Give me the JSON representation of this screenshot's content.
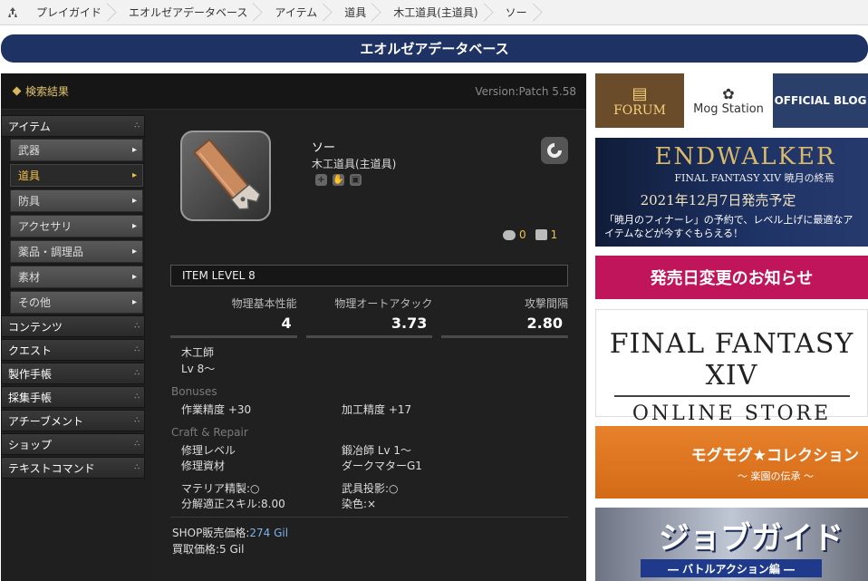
{
  "breadcrumb": {
    "items": [
      "プレイガイド",
      "エオルゼアデータベース",
      "アイテム",
      "道具",
      "木工道具(主道具)",
      "ソー"
    ]
  },
  "header": {
    "title": "エオルゼアデータベース"
  },
  "panel": {
    "search_result": "検索結果",
    "version": "Version:Patch 5.58"
  },
  "sidebar": {
    "item_category": "アイテム",
    "subs": [
      {
        "label": "武器",
        "active": false
      },
      {
        "label": "道具",
        "active": true
      },
      {
        "label": "防具",
        "active": false
      },
      {
        "label": "アクセサリ",
        "active": false
      },
      {
        "label": "薬品・調理品",
        "active": false
      },
      {
        "label": "素材",
        "active": false
      },
      {
        "label": "その他",
        "active": false
      }
    ],
    "categories": [
      "コンテンツ",
      "クエスト",
      "製作手帳",
      "採集手帳",
      "アチーブメント",
      "ショップ",
      "テキストコマンド"
    ]
  },
  "item": {
    "name": "ソー",
    "category": "木工道具(主道具)",
    "comments": "0",
    "notes": "1",
    "item_level": "ITEM LEVEL 8",
    "stats": [
      {
        "label": "物理基本性能",
        "value": "4"
      },
      {
        "label": "物理オートアタック",
        "value": "3.73"
      },
      {
        "label": "攻撃間隔",
        "value": "2.80"
      }
    ],
    "job": "木工師",
    "level": "Lv 8～",
    "bonuses_label": "Bonuses",
    "bonuses": [
      "作業精度 +30",
      "加工精度 +17"
    ],
    "craft_label": "Craft & Repair",
    "repair_level_label": "修理レベル",
    "repair_level_value": "鍛冶師 Lv 1～",
    "repair_material_label": "修理資材",
    "repair_material_value": "ダークマターG1",
    "materia": "マテリア精製:○",
    "projection": "武具投影:○",
    "desynth": "分解適正スキル:8.00",
    "dye": "染色:×",
    "shop_label": "SHOP販売価格:",
    "shop_price": "274 Gil",
    "buy_price": "買取価格:5 Gil"
  },
  "banners": {
    "forum": "FORUM",
    "mog_station": "Mog Station",
    "official_blog": "OFFICIAL BLOG",
    "endwalker_title": "ENDWALKER",
    "endwalker_sub": "FINAL FANTASY XIV  暁月の終焉",
    "endwalker_date": "2021年12月7日発売予定",
    "endwalker_note": "「暁月のフィナーレ」の予約で、レベル上げに最適なアイテムなどが今すぐもらえる！",
    "release_change": "発売日変更のお知らせ",
    "store_line1": "FINAL FANTASY XIV",
    "store_line2": "ONLINE STORE",
    "mog_collection": "モグモグ★コレクション",
    "mog_collection_sub": "～ 楽園の伝承 ～",
    "job_guide": "ジョブガイド",
    "job_guide_sub": "― バトルアクション編 ―"
  }
}
